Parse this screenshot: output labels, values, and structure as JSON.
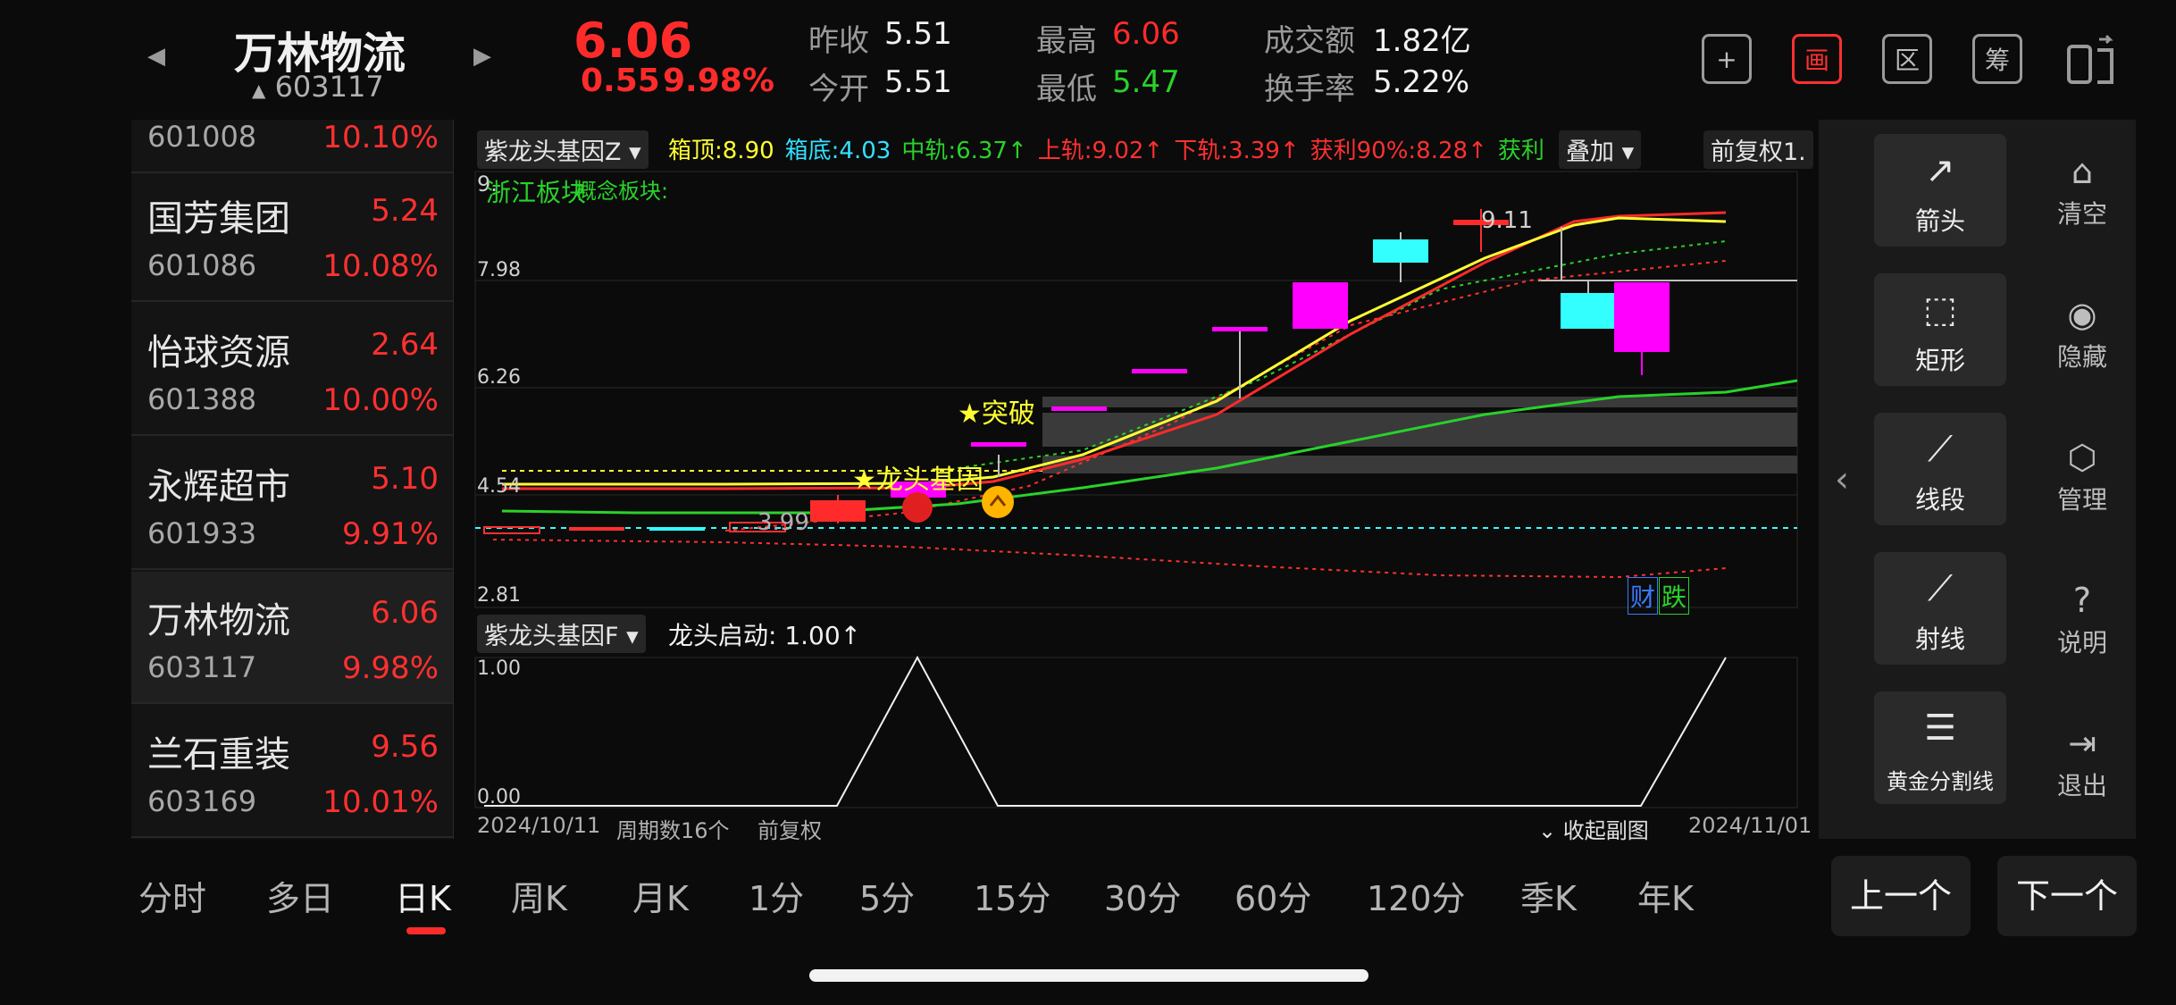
{
  "header": {
    "stock_name": "万林物流",
    "stock_code": "603117",
    "price": "6.06",
    "change": "0.55",
    "change_pct": "9.98%",
    "prev_close_label": "昨收",
    "prev_close": "5.51",
    "open_label": "今开",
    "open": "5.51",
    "high_label": "最高",
    "high": "6.06",
    "low_label": "最低",
    "low": "5.47",
    "amount_label": "成交额",
    "amount": "1.82亿",
    "turnover_label": "换手率",
    "turnover": "5.22%",
    "tools": [
      "+",
      "画",
      "区",
      "筹"
    ]
  },
  "stock_list": [
    {
      "name": "",
      "price": "",
      "code": "601008",
      "pct": "10.10%"
    },
    {
      "name": "国芳集团",
      "price": "5.24",
      "code": "601086",
      "pct": "10.08%"
    },
    {
      "name": "怡球资源",
      "price": "2.64",
      "code": "601388",
      "pct": "10.00%"
    },
    {
      "name": "永辉超市",
      "price": "5.10",
      "code": "601933",
      "pct": "9.91%"
    },
    {
      "name": "万林物流",
      "price": "6.06",
      "code": "603117",
      "pct": "9.98%"
    },
    {
      "name": "兰石重装",
      "price": "9.56",
      "code": "603169",
      "pct": "10.01%"
    }
  ],
  "main_chart": {
    "indicator_name": "紫龙头基因Z",
    "indicators": [
      {
        "text": "箱顶:8.90",
        "color": "#ffff33"
      },
      {
        "text": "箱底:4.03",
        "color": "#33e0ff"
      },
      {
        "text": "中轨:6.37↑",
        "color": "#2ad12a"
      },
      {
        "text": "上轨:9.02↑",
        "color": "#ff3030"
      },
      {
        "text": "下轨:3.39↑",
        "color": "#ff3030"
      },
      {
        "text": "获利90%:8.28↑",
        "color": "#ff3030"
      },
      {
        "text": "获利",
        "color": "#2ad12a"
      }
    ],
    "overlay_label": "叠加",
    "fuquan_label": "前复权",
    "overlap_digit": "1.",
    "sector_label": "浙江板块",
    "sector_label2": "概念板块:",
    "y_labels": [
      "9.",
      "7.98",
      "6.26",
      "4.54",
      "2.81"
    ],
    "high_mark": "9.11",
    "low_mark": "3.99",
    "breakthrough_label": "★突破",
    "dragon_label": "★龙头基因",
    "cai_label": "财",
    "die_label": "跌"
  },
  "sub_chart": {
    "indicator_name": "紫龙头基因F",
    "value_label": "龙头启动: 1.00↑",
    "y_top": "1.00",
    "y_bottom": "0.00"
  },
  "footer_bar": {
    "start_date": "2024/10/11",
    "period": "周期数16个",
    "fuquan": "前复权",
    "collapse": "收起副图",
    "end_date": "2024/11/01"
  },
  "right_panel": {
    "tools": [
      {
        "icon": "↗",
        "label": "箭头"
      },
      {
        "icon": "⬚",
        "label": "矩形"
      },
      {
        "icon": "⟋",
        "label": "线段"
      },
      {
        "icon": "⟋",
        "label": "射线"
      },
      {
        "icon": "☰",
        "label": "黄金分割线"
      }
    ],
    "side": [
      {
        "icon": "⌂",
        "label": "清空"
      },
      {
        "icon": "◉",
        "label": "隐藏"
      },
      {
        "icon": "⬡",
        "label": "管理"
      },
      {
        "icon": "?",
        "label": "说明"
      },
      {
        "icon": "⇥",
        "label": "退出"
      }
    ]
  },
  "tabs": [
    "分时",
    "多日",
    "日K",
    "周K",
    "月K",
    "1分",
    "5分",
    "15分",
    "30分",
    "60分",
    "120分",
    "季K",
    "年K"
  ],
  "nav": {
    "prev": "上一个",
    "next": "下一个"
  },
  "colors": {
    "up": "#ff2b2b",
    "down": "#2ad12a",
    "magenta": "#ff00ff",
    "cyan": "#33ffff"
  }
}
